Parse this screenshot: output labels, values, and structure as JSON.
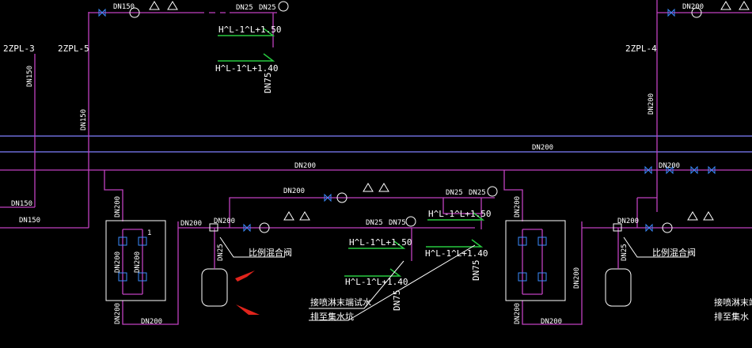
{
  "colors": {
    "background": "#000000",
    "pipe_magenta": "#c040c0",
    "pipe_blue": "#8080ff",
    "valve_blue": "#3a8cff",
    "annotation_green": "#27c93f",
    "arrow_red": "#e0241c",
    "text": "#ffffff"
  },
  "risers": {
    "r1": "2ZPL-3",
    "r2": "2ZPL-5",
    "r3": "2ZPL-4"
  },
  "pipe_labels": {
    "top_left_dn150": "DN150",
    "top_right_dn200": "DN200",
    "top_dn25_a": "DN25",
    "top_dn25_b": "DN25",
    "riser1_dn150": "DN150",
    "riser2_dn150": "DN150",
    "riser3_dn200": "DN200",
    "blue_main_dn200": "DN200",
    "magenta_main_dn200": "DN200",
    "right_main_dn200": "DN200",
    "bottom_left_dn150_a": "DN150",
    "bottom_left_dn150_b": "DN150",
    "branch_dn200": "DN200",
    "branch_dn25_a": "DN25",
    "branch_dn25_b": "DN25",
    "mid_dn25": "DN25",
    "mid_dn75": "DN75",
    "unit1_dn200_left": "DN200",
    "unit1_dn200_top": "DN200",
    "unit1_dn200_bottom": "DN200",
    "unit1_dn200_bottomleft": "DN200",
    "unit1_dn200_inner_a": "DN200",
    "unit1_dn200_inner_b": "DN200",
    "unit1_dn200_right": "DN200",
    "unit1_dn25": "DN25",
    "unit2_dn200_left": "DN200",
    "unit2_dn200_top": "DN200",
    "unit2_dn200_bottom": "DN200",
    "unit2_dn200_bottomleft": "DN200",
    "unit2_dn200_right": "DN200",
    "unit2_dn25": "DN25",
    "top_dn75": "DN75",
    "mid_dn75_b": "DN75",
    "unit1_number": "1"
  },
  "annotations": {
    "top_h150": "H^L-1^L+1.50",
    "top_h140": "H^L-1^L+1.40",
    "mid_h150": "H^L-1^L+1.50",
    "mid_h140": "H^L-1^L+1.40",
    "right_h150": "H^L-1^L+1.50",
    "right_h140": "H^L-1^L+1.40",
    "mix_valve_1": "比例混合阀",
    "mix_valve_2": "比例混合阀",
    "drain_note_1": "接喷淋末端试水",
    "drain_note_2": "排至集水坑",
    "drain_note_3": "接喷淋末端",
    "drain_note_4": "排至集水"
  }
}
